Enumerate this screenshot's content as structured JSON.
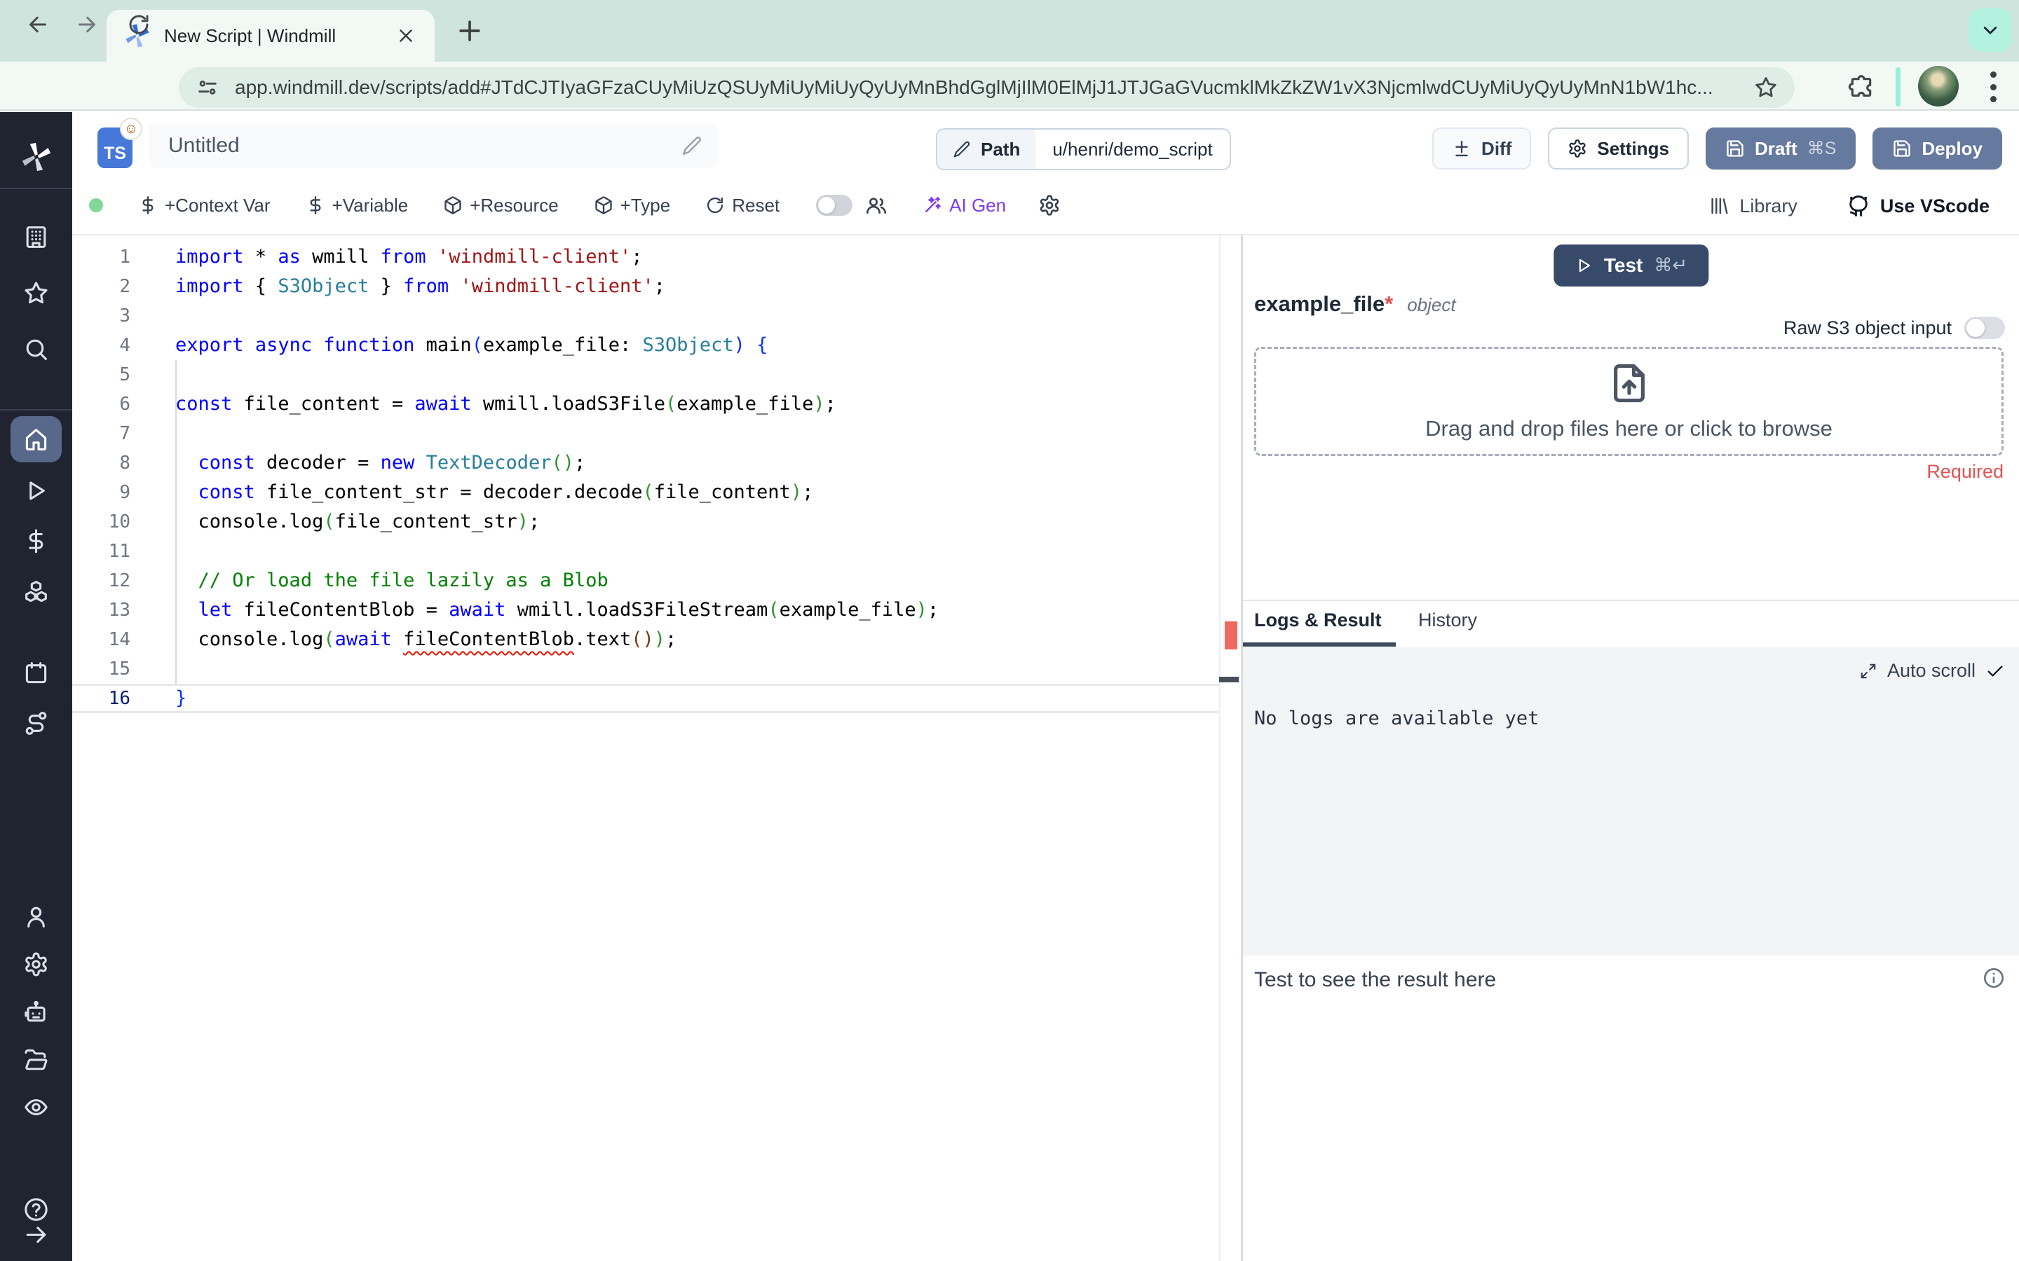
{
  "browser": {
    "tab_title": "New Script | Windmill",
    "url": "app.windmill.dev/scripts/add#JTdCJTIyaGFzaCUyMiUzQSUyMiUyMiUyQyUyMnBhdGglMjIlM0ElMjJ1JTJGaGVucmklMkZkZW1vX3NjcmlwdCUyMiUyQyUyMnN1bW1hc..."
  },
  "header": {
    "lang_badge": "TS",
    "title": "Untitled",
    "path_label": "Path",
    "path_value": "u/henri/demo_script",
    "diff_label": "Diff",
    "settings_label": "Settings",
    "draft_label": "Draft",
    "draft_shortcut": "⌘S",
    "deploy_label": "Deploy"
  },
  "toolbar": {
    "context_var": "+Context Var",
    "variable": "+Variable",
    "resource": "+Resource",
    "add_type": "+Type",
    "reset": "Reset",
    "ai_gen": "AI Gen",
    "library": "Library",
    "use_vscode": "Use VScode"
  },
  "sidebar": {
    "items": [
      {
        "icon": "building",
        "name": "workspaces"
      },
      {
        "icon": "star",
        "name": "favorites"
      },
      {
        "icon": "search",
        "name": "search"
      },
      {
        "icon": "home",
        "name": "home",
        "active": true
      },
      {
        "icon": "play",
        "name": "runs"
      },
      {
        "icon": "dollar",
        "name": "variables"
      },
      {
        "icon": "boxes",
        "name": "resources"
      },
      {
        "icon": "calendar",
        "name": "schedules"
      },
      {
        "icon": "route",
        "name": "triggers"
      },
      {
        "icon": "user",
        "name": "user"
      },
      {
        "icon": "gear",
        "name": "settings"
      },
      {
        "icon": "bot",
        "name": "workers"
      },
      {
        "icon": "folder",
        "name": "folders"
      },
      {
        "icon": "eye",
        "name": "audit-logs"
      },
      {
        "icon": "help",
        "name": "help"
      },
      {
        "icon": "arrow-right",
        "name": "expand"
      }
    ]
  },
  "editor": {
    "active_line": 16,
    "lines": [
      [
        [
          "kw",
          "import"
        ],
        [
          "pl",
          " * "
        ],
        [
          "kw",
          "as"
        ],
        [
          "pl",
          " wmill "
        ],
        [
          "kw",
          "from"
        ],
        [
          "pl",
          " "
        ],
        [
          "str",
          "'windmill-client'"
        ],
        [
          "pl",
          ";"
        ]
      ],
      [
        [
          "kw",
          "import"
        ],
        [
          "pl",
          " { "
        ],
        [
          "ty",
          "S3Object"
        ],
        [
          "pl",
          " } "
        ],
        [
          "kw",
          "from"
        ],
        [
          "pl",
          " "
        ],
        [
          "str",
          "'windmill-client'"
        ],
        [
          "pl",
          ";"
        ]
      ],
      [],
      [
        [
          "kw",
          "export"
        ],
        [
          "pl",
          " "
        ],
        [
          "kw",
          "async"
        ],
        [
          "pl",
          " "
        ],
        [
          "kw",
          "function"
        ],
        [
          "pl",
          " main"
        ],
        [
          "b1",
          "("
        ],
        [
          "pl",
          "example_file: "
        ],
        [
          "ty",
          "S3Object"
        ],
        [
          "b1",
          ")"
        ],
        [
          "pl",
          " "
        ],
        [
          "b1",
          "{"
        ]
      ],
      [],
      [
        [
          "kw",
          "const"
        ],
        [
          "pl",
          " file_content = "
        ],
        [
          "kw",
          "await"
        ],
        [
          "pl",
          " wmill.loadS3File"
        ],
        [
          "b2",
          "("
        ],
        [
          "pl",
          "example_file"
        ],
        [
          "b2",
          ")"
        ],
        [
          "pl",
          ";"
        ]
      ],
      [],
      [
        [
          "pl",
          "  "
        ],
        [
          "kw",
          "const"
        ],
        [
          "pl",
          " decoder = "
        ],
        [
          "kw",
          "new"
        ],
        [
          "pl",
          " "
        ],
        [
          "ty",
          "TextDecoder"
        ],
        [
          "b2",
          "()"
        ],
        [
          "pl",
          ";"
        ]
      ],
      [
        [
          "pl",
          "  "
        ],
        [
          "kw",
          "const"
        ],
        [
          "pl",
          " file_content_str = decoder.decode"
        ],
        [
          "b2",
          "("
        ],
        [
          "pl",
          "file_content"
        ],
        [
          "b2",
          ")"
        ],
        [
          "pl",
          ";"
        ]
      ],
      [
        [
          "pl",
          "  console.log"
        ],
        [
          "b2",
          "("
        ],
        [
          "pl",
          "file_content_str"
        ],
        [
          "b2",
          ")"
        ],
        [
          "pl",
          ";"
        ]
      ],
      [],
      [
        [
          "pl",
          "  "
        ],
        [
          "cm",
          "// Or load the file lazily as a Blob"
        ]
      ],
      [
        [
          "pl",
          "  "
        ],
        [
          "kw",
          "let"
        ],
        [
          "pl",
          " fileContentBlob = "
        ],
        [
          "kw",
          "await"
        ],
        [
          "pl",
          " wmill.loadS3FileStream"
        ],
        [
          "b2",
          "("
        ],
        [
          "pl",
          "example_file"
        ],
        [
          "b2",
          ")"
        ],
        [
          "pl",
          ";"
        ]
      ],
      [
        [
          "pl",
          "  console.log"
        ],
        [
          "b2",
          "("
        ],
        [
          "kw",
          "await"
        ],
        [
          "pl",
          " "
        ],
        [
          "err",
          "fileContentBlob"
        ],
        [
          "pl",
          ".text"
        ],
        [
          "b3",
          "()"
        ],
        [
          "b2",
          ")"
        ],
        [
          "pl",
          ";"
        ]
      ],
      [],
      [
        [
          "b1",
          "}"
        ]
      ]
    ]
  },
  "run": {
    "test_label": "Test",
    "test_shortcut": "⌘↵",
    "arg_name": "example_file",
    "required_mark": "*",
    "arg_type": "object",
    "raw_s3_label": "Raw S3 object input",
    "dropzone_label": "Drag and drop files here or click to browse",
    "required_label": "Required"
  },
  "logs": {
    "tab_logs": "Logs & Result",
    "tab_history": "History",
    "autoscroll_label": "Auto scroll",
    "empty_message": "No logs are available yet",
    "result_placeholder": "Test to see the result here"
  },
  "colors": {
    "accent_slate": "#66799e",
    "test_button": "#374a6a",
    "ai_gen_purple": "#7c3aed",
    "sidebar_bg": "#1f2430",
    "sidebar_active": "#57688a",
    "required_red": "#e05252",
    "tab_strip": "#cfe4dd"
  }
}
